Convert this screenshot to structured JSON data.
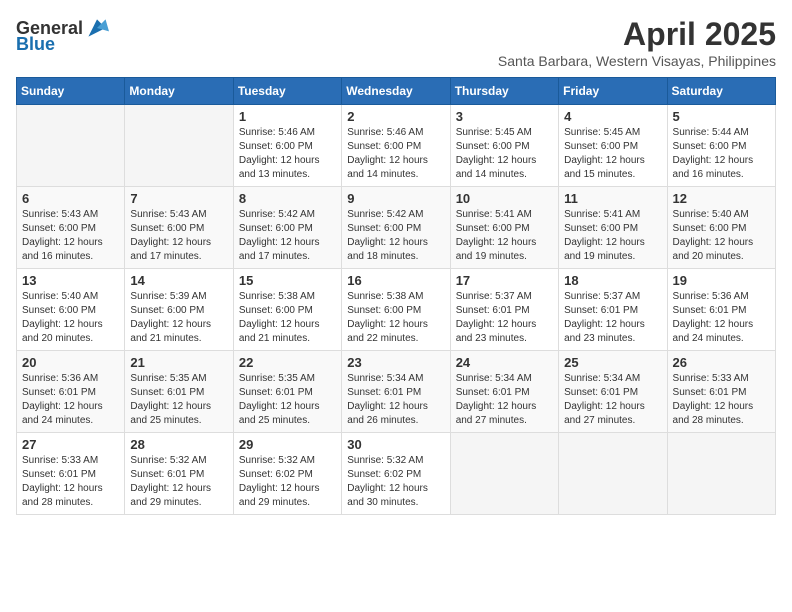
{
  "header": {
    "logo_general": "General",
    "logo_blue": "Blue",
    "month_title": "April 2025",
    "location": "Santa Barbara, Western Visayas, Philippines"
  },
  "weekdays": [
    "Sunday",
    "Monday",
    "Tuesday",
    "Wednesday",
    "Thursday",
    "Friday",
    "Saturday"
  ],
  "weeks": [
    [
      {
        "day": "",
        "info": ""
      },
      {
        "day": "",
        "info": ""
      },
      {
        "day": "1",
        "info": "Sunrise: 5:46 AM\nSunset: 6:00 PM\nDaylight: 12 hours and 13 minutes."
      },
      {
        "day": "2",
        "info": "Sunrise: 5:46 AM\nSunset: 6:00 PM\nDaylight: 12 hours and 14 minutes."
      },
      {
        "day": "3",
        "info": "Sunrise: 5:45 AM\nSunset: 6:00 PM\nDaylight: 12 hours and 14 minutes."
      },
      {
        "day": "4",
        "info": "Sunrise: 5:45 AM\nSunset: 6:00 PM\nDaylight: 12 hours and 15 minutes."
      },
      {
        "day": "5",
        "info": "Sunrise: 5:44 AM\nSunset: 6:00 PM\nDaylight: 12 hours and 16 minutes."
      }
    ],
    [
      {
        "day": "6",
        "info": "Sunrise: 5:43 AM\nSunset: 6:00 PM\nDaylight: 12 hours and 16 minutes."
      },
      {
        "day": "7",
        "info": "Sunrise: 5:43 AM\nSunset: 6:00 PM\nDaylight: 12 hours and 17 minutes."
      },
      {
        "day": "8",
        "info": "Sunrise: 5:42 AM\nSunset: 6:00 PM\nDaylight: 12 hours and 17 minutes."
      },
      {
        "day": "9",
        "info": "Sunrise: 5:42 AM\nSunset: 6:00 PM\nDaylight: 12 hours and 18 minutes."
      },
      {
        "day": "10",
        "info": "Sunrise: 5:41 AM\nSunset: 6:00 PM\nDaylight: 12 hours and 19 minutes."
      },
      {
        "day": "11",
        "info": "Sunrise: 5:41 AM\nSunset: 6:00 PM\nDaylight: 12 hours and 19 minutes."
      },
      {
        "day": "12",
        "info": "Sunrise: 5:40 AM\nSunset: 6:00 PM\nDaylight: 12 hours and 20 minutes."
      }
    ],
    [
      {
        "day": "13",
        "info": "Sunrise: 5:40 AM\nSunset: 6:00 PM\nDaylight: 12 hours and 20 minutes."
      },
      {
        "day": "14",
        "info": "Sunrise: 5:39 AM\nSunset: 6:00 PM\nDaylight: 12 hours and 21 minutes."
      },
      {
        "day": "15",
        "info": "Sunrise: 5:38 AM\nSunset: 6:00 PM\nDaylight: 12 hours and 21 minutes."
      },
      {
        "day": "16",
        "info": "Sunrise: 5:38 AM\nSunset: 6:00 PM\nDaylight: 12 hours and 22 minutes."
      },
      {
        "day": "17",
        "info": "Sunrise: 5:37 AM\nSunset: 6:01 PM\nDaylight: 12 hours and 23 minutes."
      },
      {
        "day": "18",
        "info": "Sunrise: 5:37 AM\nSunset: 6:01 PM\nDaylight: 12 hours and 23 minutes."
      },
      {
        "day": "19",
        "info": "Sunrise: 5:36 AM\nSunset: 6:01 PM\nDaylight: 12 hours and 24 minutes."
      }
    ],
    [
      {
        "day": "20",
        "info": "Sunrise: 5:36 AM\nSunset: 6:01 PM\nDaylight: 12 hours and 24 minutes."
      },
      {
        "day": "21",
        "info": "Sunrise: 5:35 AM\nSunset: 6:01 PM\nDaylight: 12 hours and 25 minutes."
      },
      {
        "day": "22",
        "info": "Sunrise: 5:35 AM\nSunset: 6:01 PM\nDaylight: 12 hours and 25 minutes."
      },
      {
        "day": "23",
        "info": "Sunrise: 5:34 AM\nSunset: 6:01 PM\nDaylight: 12 hours and 26 minutes."
      },
      {
        "day": "24",
        "info": "Sunrise: 5:34 AM\nSunset: 6:01 PM\nDaylight: 12 hours and 27 minutes."
      },
      {
        "day": "25",
        "info": "Sunrise: 5:34 AM\nSunset: 6:01 PM\nDaylight: 12 hours and 27 minutes."
      },
      {
        "day": "26",
        "info": "Sunrise: 5:33 AM\nSunset: 6:01 PM\nDaylight: 12 hours and 28 minutes."
      }
    ],
    [
      {
        "day": "27",
        "info": "Sunrise: 5:33 AM\nSunset: 6:01 PM\nDaylight: 12 hours and 28 minutes."
      },
      {
        "day": "28",
        "info": "Sunrise: 5:32 AM\nSunset: 6:01 PM\nDaylight: 12 hours and 29 minutes."
      },
      {
        "day": "29",
        "info": "Sunrise: 5:32 AM\nSunset: 6:02 PM\nDaylight: 12 hours and 29 minutes."
      },
      {
        "day": "30",
        "info": "Sunrise: 5:32 AM\nSunset: 6:02 PM\nDaylight: 12 hours and 30 minutes."
      },
      {
        "day": "",
        "info": ""
      },
      {
        "day": "",
        "info": ""
      },
      {
        "day": "",
        "info": ""
      }
    ]
  ]
}
